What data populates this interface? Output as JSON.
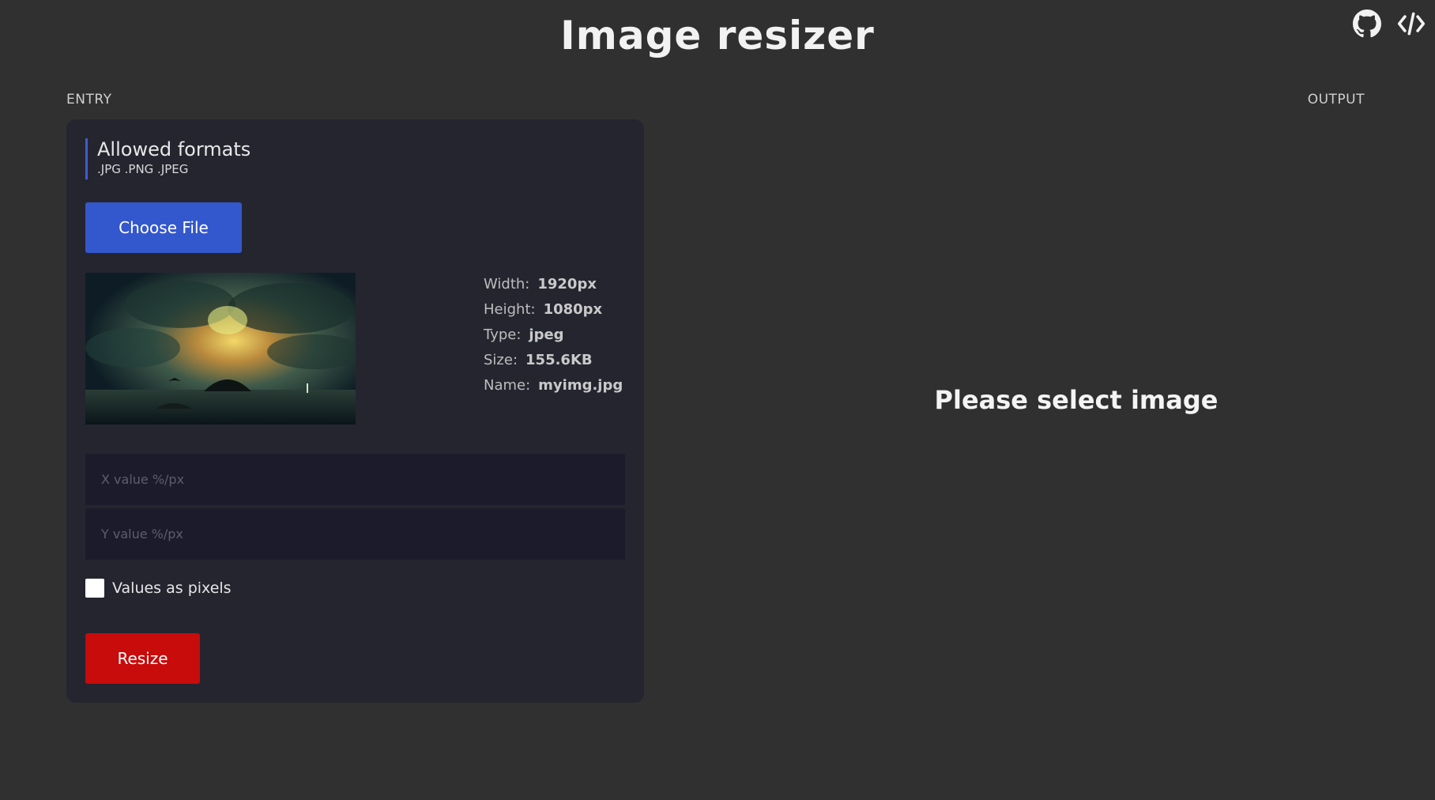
{
  "header": {
    "title": "Image resizer",
    "icons": [
      "github-icon",
      "code-icon"
    ]
  },
  "entry": {
    "label": "ENTRY",
    "formats_title": "Allowed formats",
    "formats_list": ".JPG .PNG .JPEG",
    "choose_file_label": "Choose File",
    "info": {
      "width_label": "Width:",
      "width_value": "1920px",
      "height_label": "Height:",
      "height_value": "1080px",
      "type_label": "Type:",
      "type_value": "jpeg",
      "size_label": "Size:",
      "size_value": "155.6KB",
      "name_label": "Name:",
      "name_value": "myimg.jpg"
    },
    "x_input": {
      "value": "",
      "placeholder": "X value %/px"
    },
    "y_input": {
      "value": "",
      "placeholder": "Y value %/px"
    },
    "checkbox": {
      "label": "Values as pixels",
      "checked": false
    },
    "resize_label": "Resize"
  },
  "output": {
    "label": "OUTPUT",
    "placeholder": "Please select image"
  },
  "colors": {
    "background": "#303030",
    "panel": "#252530",
    "input": "#1b1b2c",
    "primary": "#3357cc",
    "danger": "#c80b0b",
    "accent_border": "#3b5fd1"
  }
}
